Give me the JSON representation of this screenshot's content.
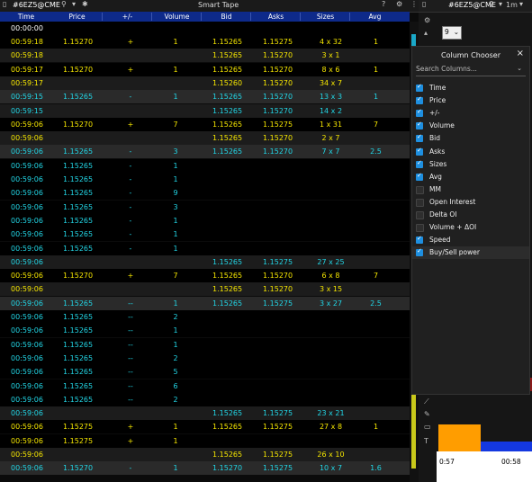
{
  "window": {
    "symbol": "#6EZ5@CME",
    "title": "Smart Tape"
  },
  "right_panel": {
    "symbol": "#6EZ5@CME",
    "timeframe": "1m",
    "dropdown_value": "9",
    "time_labels": [
      "0:57",
      "00:58"
    ]
  },
  "columns": [
    "Time",
    "Price",
    "+/-",
    "Volume",
    "Bid",
    "Asks",
    "Sizes",
    "Avg"
  ],
  "current_time": "00:00:00",
  "colors": {
    "buy": "#f5e600",
    "sell": "#22d6e6",
    "header": "#0e2a8a",
    "checkbox": "#1e8fe0"
  },
  "rows": [
    {
      "time": "00:59:18",
      "price": "1.15270",
      "pm": "+",
      "vol": "1",
      "bid": "1.15265",
      "ask": "1.15275",
      "size": "4 x 32",
      "avg": "1",
      "color": "buy",
      "bg": "#000000"
    },
    {
      "time": "00:59:18",
      "price": "",
      "pm": "",
      "vol": "",
      "bid": "1.15265",
      "ask": "1.15270",
      "size": "3 x 1",
      "avg": "",
      "color": "buy",
      "bg": "#1c1c1c"
    },
    {
      "time": "00:59:17",
      "price": "1.15270",
      "pm": "+",
      "vol": "1",
      "bid": "1.15265",
      "ask": "1.15270",
      "size": "8 x 6",
      "avg": "1",
      "color": "buy",
      "bg": "#000000"
    },
    {
      "time": "00:59:17",
      "price": "",
      "pm": "",
      "vol": "",
      "bid": "1.15260",
      "ask": "1.15270",
      "size": "34 x 7",
      "avg": "",
      "color": "buy",
      "bg": "#1c1c1c"
    },
    {
      "time": "00:59:15",
      "price": "1.15265",
      "pm": "-",
      "vol": "1",
      "bid": "1.15265",
      "ask": "1.15270",
      "size": "13 x 3",
      "avg": "1",
      "color": "sell",
      "bg": "#2a2a2a"
    },
    {
      "time": "00:59:15",
      "price": "",
      "pm": "",
      "vol": "",
      "bid": "1.15265",
      "ask": "1.15270",
      "size": "14 x 2",
      "avg": "",
      "color": "sell",
      "bg": "#1c1c1c"
    },
    {
      "time": "00:59:06",
      "price": "1.15270",
      "pm": "+",
      "vol": "7",
      "bid": "1.15265",
      "ask": "1.15275",
      "size": "1 x 31",
      "avg": "7",
      "color": "buy",
      "bg": "#000000"
    },
    {
      "time": "00:59:06",
      "price": "",
      "pm": "",
      "vol": "",
      "bid": "1.15265",
      "ask": "1.15270",
      "size": "2 x 7",
      "avg": "",
      "color": "buy",
      "bg": "#1c1c1c"
    },
    {
      "time": "00:59:06",
      "price": "1.15265",
      "pm": "-",
      "vol": "3",
      "bid": "1.15265",
      "ask": "1.15270",
      "size": "7 x 7",
      "avg": "2.5",
      "color": "sell",
      "bg": "#2a2a2a"
    },
    {
      "time": "00:59:06",
      "price": "1.15265",
      "pm": "-",
      "vol": "1",
      "bid": "",
      "ask": "",
      "size": "",
      "avg": "",
      "color": "sell",
      "bg": "#000000"
    },
    {
      "time": "00:59:06",
      "price": "1.15265",
      "pm": "-",
      "vol": "1",
      "bid": "",
      "ask": "",
      "size": "",
      "avg": "",
      "color": "sell",
      "bg": "#000000"
    },
    {
      "time": "00:59:06",
      "price": "1.15265",
      "pm": "-",
      "vol": "9",
      "bid": "",
      "ask": "",
      "size": "",
      "avg": "",
      "color": "sell",
      "bg": "#000000"
    },
    {
      "time": "00:59:06",
      "price": "1.15265",
      "pm": "-",
      "vol": "3",
      "bid": "",
      "ask": "",
      "size": "",
      "avg": "",
      "color": "sell",
      "bg": "#000000"
    },
    {
      "time": "00:59:06",
      "price": "1.15265",
      "pm": "-",
      "vol": "1",
      "bid": "",
      "ask": "",
      "size": "",
      "avg": "",
      "color": "sell",
      "bg": "#000000"
    },
    {
      "time": "00:59:06",
      "price": "1.15265",
      "pm": "-",
      "vol": "1",
      "bid": "",
      "ask": "",
      "size": "",
      "avg": "",
      "color": "sell",
      "bg": "#000000"
    },
    {
      "time": "00:59:06",
      "price": "1.15265",
      "pm": "-",
      "vol": "1",
      "bid": "",
      "ask": "",
      "size": "",
      "avg": "",
      "color": "sell",
      "bg": "#000000"
    },
    {
      "time": "00:59:06",
      "price": "",
      "pm": "",
      "vol": "",
      "bid": "1.15265",
      "ask": "1.15275",
      "size": "27 x 25",
      "avg": "",
      "color": "sell",
      "bg": "#1c1c1c"
    },
    {
      "time": "00:59:06",
      "price": "1.15270",
      "pm": "+",
      "vol": "7",
      "bid": "1.15265",
      "ask": "1.15270",
      "size": "6 x 8",
      "avg": "7",
      "color": "buy",
      "bg": "#000000"
    },
    {
      "time": "00:59:06",
      "price": "",
      "pm": "",
      "vol": "",
      "bid": "1.15265",
      "ask": "1.15270",
      "size": "3 x 15",
      "avg": "",
      "color": "buy",
      "bg": "#1c1c1c"
    },
    {
      "time": "00:59:06",
      "price": "1.15265",
      "pm": "--",
      "vol": "1",
      "bid": "1.15265",
      "ask": "1.15275",
      "size": "3 x 27",
      "avg": "2.5",
      "color": "sell",
      "bg": "#2a2a2a"
    },
    {
      "time": "00:59:06",
      "price": "1.15265",
      "pm": "--",
      "vol": "2",
      "bid": "",
      "ask": "",
      "size": "",
      "avg": "",
      "color": "sell",
      "bg": "#000000"
    },
    {
      "time": "00:59:06",
      "price": "1.15265",
      "pm": "--",
      "vol": "1",
      "bid": "",
      "ask": "",
      "size": "",
      "avg": "",
      "color": "sell",
      "bg": "#000000"
    },
    {
      "time": "00:59:06",
      "price": "1.15265",
      "pm": "--",
      "vol": "1",
      "bid": "",
      "ask": "",
      "size": "",
      "avg": "",
      "color": "sell",
      "bg": "#000000"
    },
    {
      "time": "00:59:06",
      "price": "1.15265",
      "pm": "--",
      "vol": "2",
      "bid": "",
      "ask": "",
      "size": "",
      "avg": "",
      "color": "sell",
      "bg": "#000000"
    },
    {
      "time": "00:59:06",
      "price": "1.15265",
      "pm": "--",
      "vol": "5",
      "bid": "",
      "ask": "",
      "size": "",
      "avg": "",
      "color": "sell",
      "bg": "#000000"
    },
    {
      "time": "00:59:06",
      "price": "1.15265",
      "pm": "--",
      "vol": "6",
      "bid": "",
      "ask": "",
      "size": "",
      "avg": "",
      "color": "sell",
      "bg": "#000000"
    },
    {
      "time": "00:59:06",
      "price": "1.15265",
      "pm": "--",
      "vol": "2",
      "bid": "",
      "ask": "",
      "size": "",
      "avg": "",
      "color": "sell",
      "bg": "#000000"
    },
    {
      "time": "00:59:06",
      "price": "",
      "pm": "",
      "vol": "",
      "bid": "1.15265",
      "ask": "1.15275",
      "size": "23 x 21",
      "avg": "",
      "color": "sell",
      "bg": "#1c1c1c"
    },
    {
      "time": "00:59:06",
      "price": "1.15275",
      "pm": "+",
      "vol": "1",
      "bid": "1.15265",
      "ask": "1.15275",
      "size": "27 x 8",
      "avg": "1",
      "color": "buy",
      "bg": "#000000"
    },
    {
      "time": "00:59:06",
      "price": "1.15275",
      "pm": "+",
      "vol": "1",
      "bid": "",
      "ask": "",
      "size": "",
      "avg": "",
      "color": "buy",
      "bg": "#000000"
    },
    {
      "time": "00:59:06",
      "price": "",
      "pm": "",
      "vol": "",
      "bid": "1.15265",
      "ask": "1.15275",
      "size": "26 x 10",
      "avg": "",
      "color": "buy",
      "bg": "#1c1c1c"
    },
    {
      "time": "00:59:06",
      "price": "1.15270",
      "pm": "-",
      "vol": "1",
      "bid": "1.15270",
      "ask": "1.15275",
      "size": "10 x 7",
      "avg": "1.6",
      "color": "sell",
      "bg": "#2a2a2a"
    }
  ],
  "column_chooser": {
    "title": "Column Chooser",
    "search_placeholder": "Search Columns...",
    "items": [
      {
        "label": "Time",
        "checked": true
      },
      {
        "label": "Price",
        "checked": true
      },
      {
        "label": "+/-",
        "checked": true
      },
      {
        "label": "Volume",
        "checked": true
      },
      {
        "label": "Bid",
        "checked": true
      },
      {
        "label": "Asks",
        "checked": true
      },
      {
        "label": "Sizes",
        "checked": true
      },
      {
        "label": "Avg",
        "checked": true
      },
      {
        "label": "MM",
        "checked": false
      },
      {
        "label": "Open Interest",
        "checked": false
      },
      {
        "label": "Delta OI",
        "checked": false
      },
      {
        "label": "Volume + ΔOI",
        "checked": false
      },
      {
        "label": "Speed",
        "checked": true
      },
      {
        "label": "Buy/Sell power",
        "checked": true
      }
    ]
  }
}
